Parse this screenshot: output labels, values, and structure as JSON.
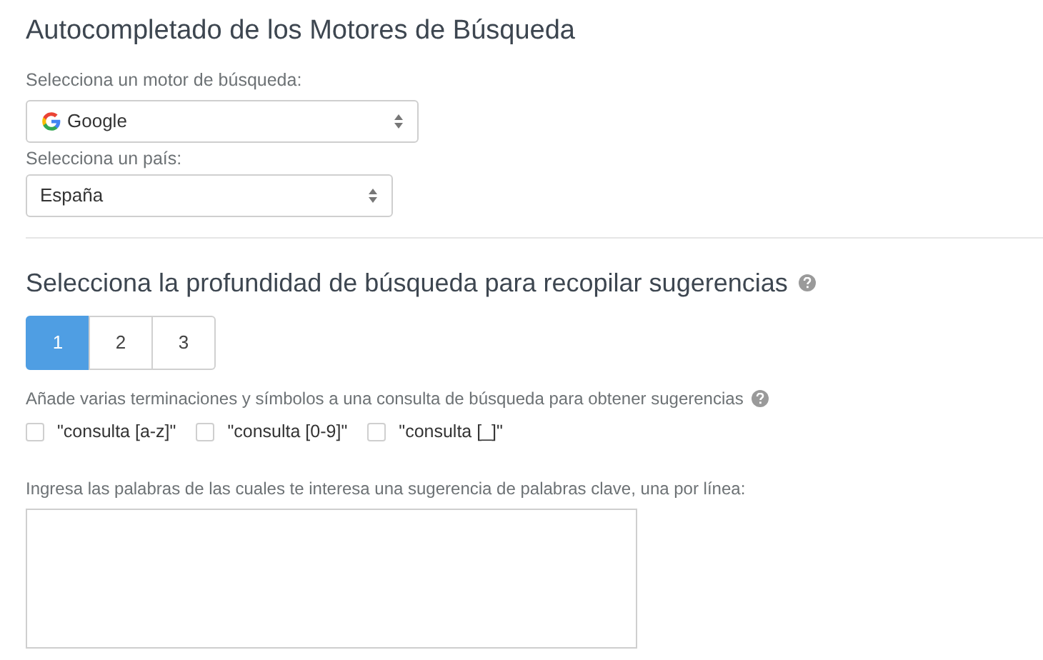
{
  "title": "Autocompletado de los Motores de Búsqueda",
  "engine": {
    "label": "Selecciona un motor de búsqueda:",
    "value": "Google"
  },
  "country": {
    "label": "Selecciona un país:",
    "value": "España"
  },
  "depth": {
    "heading": "Selecciona la profundidad de búsqueda para recopilar sugerencias",
    "options": [
      {
        "label": "1",
        "selected": true
      },
      {
        "label": "2",
        "selected": false
      },
      {
        "label": "3",
        "selected": false
      }
    ]
  },
  "suffixes": {
    "label": "Añade varias terminaciones y símbolos a una consulta de búsqueda para obtener sugerencias",
    "options": [
      {
        "label": "\"consulta [a-z]\"",
        "checked": false
      },
      {
        "label": "\"consulta [0-9]\"",
        "checked": false
      },
      {
        "label": "\"consulta [_]\"",
        "checked": false
      }
    ]
  },
  "keywords": {
    "label": "Ingresa las palabras de las cuales te interesa una sugerencia de palabras clave, una por línea:"
  }
}
